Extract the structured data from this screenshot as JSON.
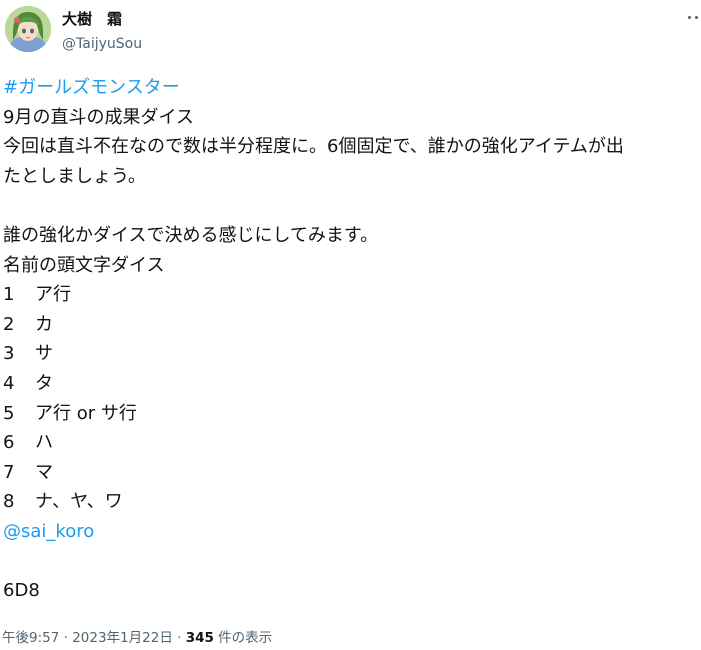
{
  "author": {
    "display_name": "大樹　霜",
    "handle": "@TaijyuSou",
    "avatar_icon": "anime-character-avatar-icon"
  },
  "menu": {
    "icon": "more-options-icon"
  },
  "tweet": {
    "hashtag": "#ガールズモンスター",
    "line1": "9月の直斗の成果ダイス",
    "line2": "今回は直斗不在なので数は半分程度に。6個固定で、誰かの強化アイテムが出",
    "line3": "たとしましょう。",
    "line4": "誰の強化かダイスで決める感じにしてみます。",
    "line5": "名前の頭文字ダイス",
    "dice_list": [
      {
        "num": "1",
        "label": "ア行"
      },
      {
        "num": "2",
        "label": "カ"
      },
      {
        "num": "3",
        "label": "サ"
      },
      {
        "num": "4",
        "label": "タ"
      },
      {
        "num": "5",
        "label": "ア行 or サ行"
      },
      {
        "num": "6",
        "label": "ハ"
      },
      {
        "num": "7",
        "label": "マ"
      },
      {
        "num": "8",
        "label": "ナ、ヤ、ワ"
      }
    ],
    "mention": "@sai_koro",
    "dice_command": "6D8"
  },
  "meta": {
    "timestamp": "午後9:57 · 2023年1月22日 · ",
    "views_count": "345",
    "views_label": " 件の表示"
  },
  "colors": {
    "link": "#1d9bf0",
    "text": "#0f1419",
    "secondary": "#536471"
  }
}
